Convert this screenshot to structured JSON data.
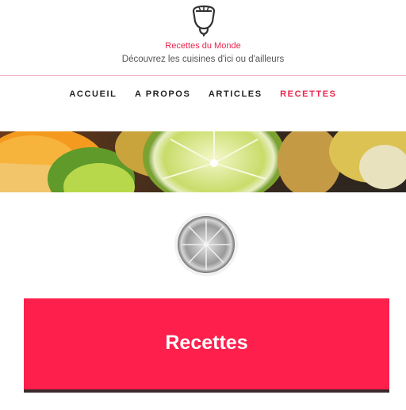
{
  "site": {
    "title": "Recettes du Monde",
    "description": "Découvrez les cuisines d'ici ou d'ailleurs",
    "logo_icon": "citrus-juicer-icon"
  },
  "nav": {
    "items": [
      {
        "label": "ACCUEIL"
      },
      {
        "label": "A PROPOS"
      },
      {
        "label": "ARTICLES"
      },
      {
        "label": "RECETTES"
      }
    ],
    "active_index": 3
  },
  "banner": {
    "image": "citrus-fruits-banner"
  },
  "page": {
    "thumb_image": "lime-slice-grayscale",
    "heading": "Recettes"
  },
  "colors": {
    "accent": "#fe1f4c",
    "title_text": "#e8244c",
    "nav_text": "#222222",
    "divider": "#f0b3c6"
  }
}
